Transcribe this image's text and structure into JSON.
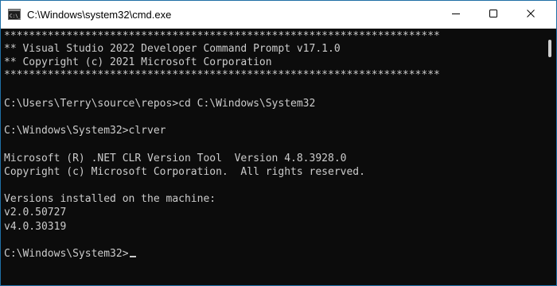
{
  "window": {
    "title": "C:\\Windows\\system32\\cmd.exe",
    "icon": "cmd-icon",
    "icon_label": "C:\\_"
  },
  "caption_buttons": {
    "minimize": "minimize-icon",
    "maximize": "maximize-icon",
    "close": "close-icon"
  },
  "console": {
    "lines": [
      "**********************************************************************",
      "** Visual Studio 2022 Developer Command Prompt v17.1.0",
      "** Copyright (c) 2021 Microsoft Corporation",
      "**********************************************************************",
      "",
      "C:\\Users\\Terry\\source\\repos>cd C:\\Windows\\System32",
      "",
      "C:\\Windows\\System32>clrver",
      "",
      "Microsoft (R) .NET CLR Version Tool  Version 4.8.3928.0",
      "Copyright (c) Microsoft Corporation.  All rights reserved.",
      "",
      "Versions installed on the machine:",
      "v2.0.50727",
      "v4.0.30319",
      "",
      "C:\\Windows\\System32>"
    ]
  },
  "colors": {
    "console_background": "#0c0c0c",
    "console_text": "#cccccc",
    "titlebar_background": "#ffffff",
    "window_border": "#1f6fa6"
  }
}
